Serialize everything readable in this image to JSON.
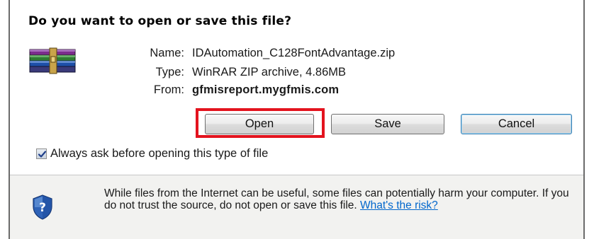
{
  "dialog": {
    "title": "Do you want to open or save this file?",
    "file": {
      "icon": "winrar-archive-icon",
      "name_label": "Name:",
      "name_value": "IDAutomation_C128FontAdvantage.zip",
      "type_label": "Type:",
      "type_value": "WinRAR ZIP archive, 4.86MB",
      "from_label": "From:",
      "from_value": "gfmisreport.mygfmis.com"
    },
    "buttons": {
      "open": "Open",
      "save": "Save",
      "cancel": "Cancel"
    },
    "always_ask": {
      "checked": true,
      "label": "Always ask before opening this type of file"
    },
    "warning": {
      "icon": "security-shield-icon",
      "text": "While files from the Internet can be useful, some files can potentially harm your computer. If you do not trust the source, do not open or save this file.",
      "link_text": "What's the risk?"
    },
    "highlight_color": "#e3131e",
    "link_color": "#0066cc"
  }
}
